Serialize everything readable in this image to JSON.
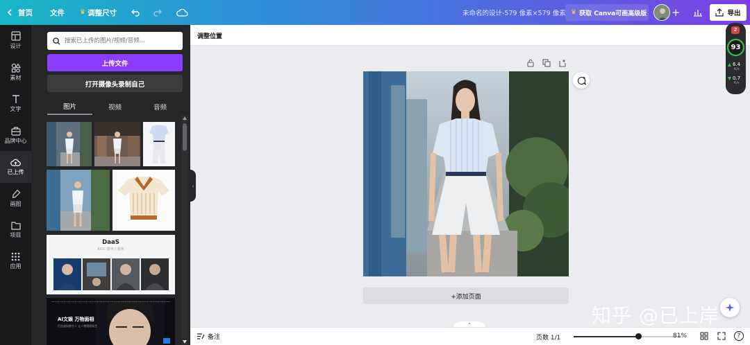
{
  "topbar": {
    "home": "首页",
    "file": "文件",
    "resize": "调整尺寸",
    "doc_title": "未命名的设计-579 像素×579 像素",
    "upgrade": "获取 Canva可画高级版",
    "export": "导出"
  },
  "sidebar": {
    "items": [
      {
        "label": "设计",
        "icon": "layout-icon"
      },
      {
        "label": "素材",
        "icon": "shapes-icon"
      },
      {
        "label": "文字",
        "icon": "text-icon"
      },
      {
        "label": "品牌中心",
        "icon": "brand-icon"
      },
      {
        "label": "已上传",
        "icon": "cloud-upload-icon"
      },
      {
        "label": "画图",
        "icon": "draw-icon"
      },
      {
        "label": "项目",
        "icon": "folder-icon"
      },
      {
        "label": "应用",
        "icon": "apps-icon"
      }
    ]
  },
  "panel": {
    "search_placeholder": "搜索已上传的图片/视频/音频...",
    "upload_label": "上传文件",
    "camera_label": "打开摄像头录制自己",
    "tabs": [
      "图片",
      "视频",
      "音频"
    ],
    "daas": {
      "title": "DaaS",
      "subtitle": "AIGC 数字人服务"
    },
    "ai_banner": {
      "title": "AI文娱 万物面相",
      "subtitle": "打造虚拟数字人 让人物栩栩如生"
    }
  },
  "context": {
    "label": "调整位置"
  },
  "canvas": {
    "add_page": "+添加页面"
  },
  "bottom": {
    "notes": "备注",
    "pages": "页数 1/1",
    "zoom": "81%",
    "zoom_level": 0.6
  },
  "perf": {
    "badge": "2",
    "score": "93",
    "up": "6.4",
    "up_unit": "K/s",
    "down": "0.7",
    "down_unit": "K/s"
  },
  "watermark": "知乎 @已上岸",
  "colors": {
    "accent": "#8b3dff",
    "panel": "#252627",
    "sidebar": "#18191b"
  }
}
